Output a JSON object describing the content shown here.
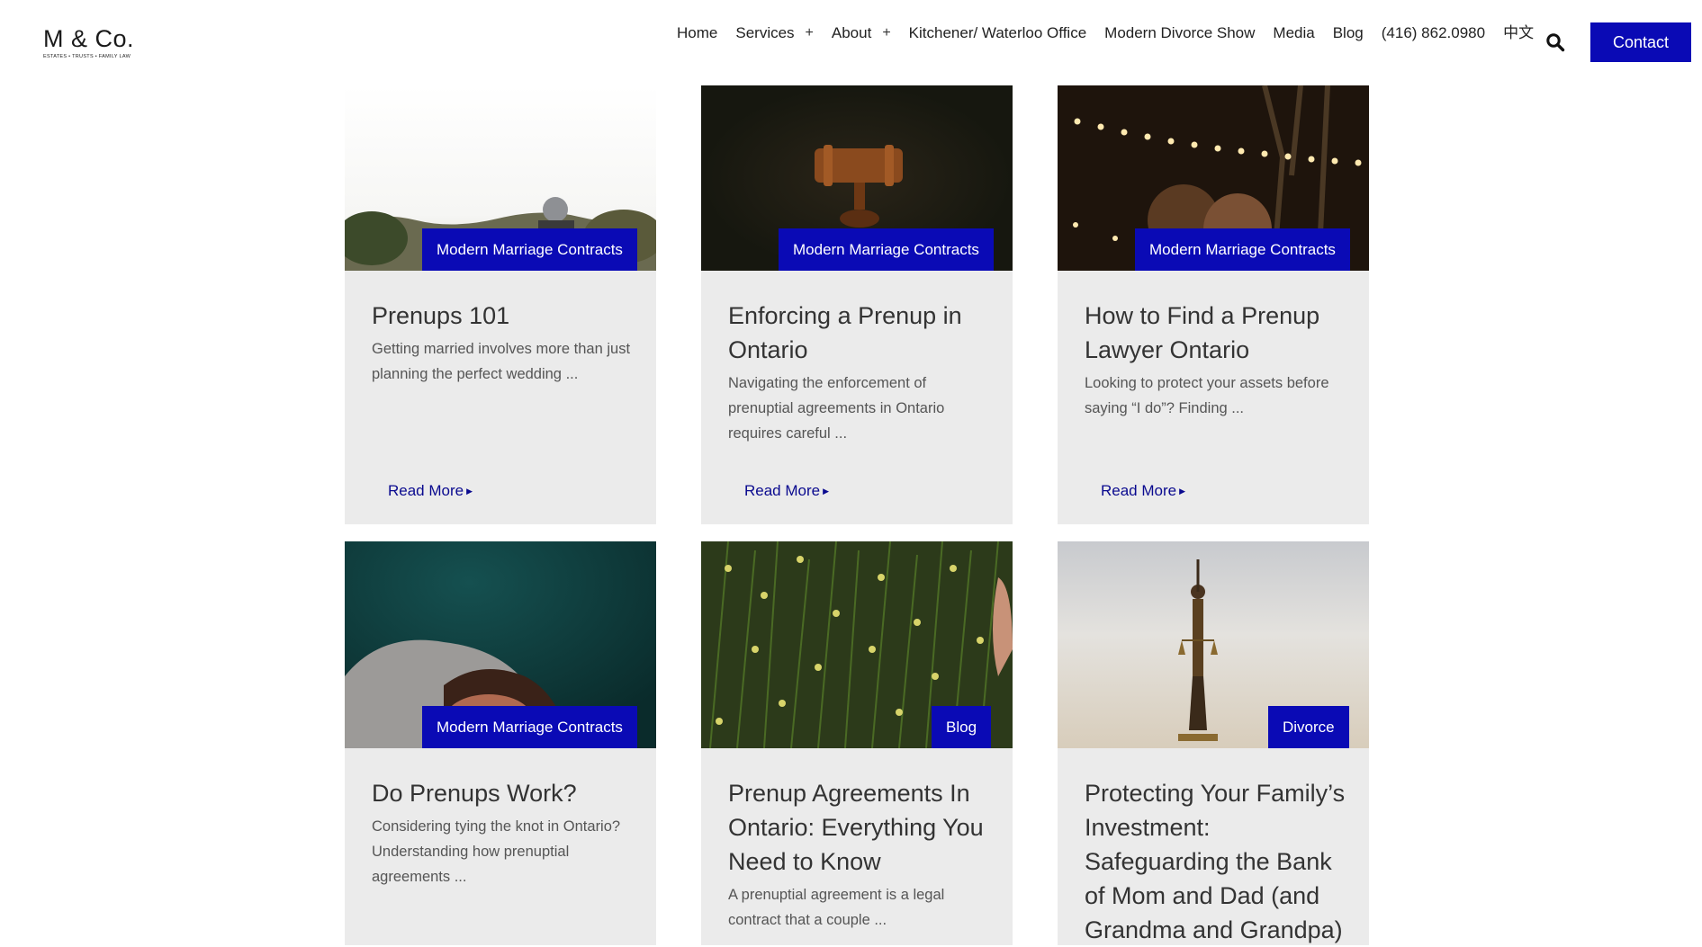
{
  "brand": {
    "logo_text": "M & Co.",
    "tagline": "ESTATES • TRUSTS • FAMILY LAW"
  },
  "nav": {
    "items": [
      {
        "label": "Home",
        "has_submenu": false
      },
      {
        "label": "Services",
        "has_submenu": true
      },
      {
        "label": "About",
        "has_submenu": true
      },
      {
        "label": "Kitchener/ Waterloo Office",
        "has_submenu": false
      },
      {
        "label": "Modern Divorce Show",
        "has_submenu": false
      },
      {
        "label": "Media",
        "has_submenu": false
      },
      {
        "label": "Blog",
        "has_submenu": false
      },
      {
        "label": "(416) 862.0980",
        "has_submenu": false
      },
      {
        "label": "中文",
        "has_submenu": false
      }
    ],
    "submenu_glyph": "+",
    "search_icon": "search-icon",
    "contact_label": "Contact"
  },
  "colors": {
    "accent": "#0a0ab5",
    "card_bg": "#ebebeb",
    "link": "#0a0a8f"
  },
  "posts": [
    {
      "category": "Modern Marriage Contracts",
      "title": "Prenups 101",
      "excerpt": "Getting married involves more than just planning the perfect wedding ...",
      "read_more": "Read More"
    },
    {
      "category": "Modern Marriage Contracts",
      "title": "Enforcing a Prenup in Ontario",
      "excerpt": "Navigating the enforcement of prenuptial agreements in Ontario requires careful ...",
      "read_more": "Read More"
    },
    {
      "category": "Modern Marriage Contracts",
      "title": "How to Find a Prenup Lawyer Ontario",
      "excerpt": "Looking to protect your assets before saying “I do”? Finding ...",
      "read_more": "Read More"
    },
    {
      "category": "Modern Marriage Contracts",
      "title": "Do Prenups Work?",
      "excerpt": "Considering tying the knot in Ontario? Understanding how prenuptial agreements ...",
      "read_more": ""
    },
    {
      "category": "Blog",
      "title": "Prenup Agreements In Ontario: Everything You Need to Know",
      "excerpt": "A prenuptial agreement is a legal contract that a couple ...",
      "read_more": ""
    },
    {
      "category": "Divorce",
      "title": "Protecting Your Family’s Investment: Safeguarding the Bank of Mom and Dad (and Grandma and Grandpa)",
      "excerpt": "",
      "read_more": ""
    }
  ]
}
